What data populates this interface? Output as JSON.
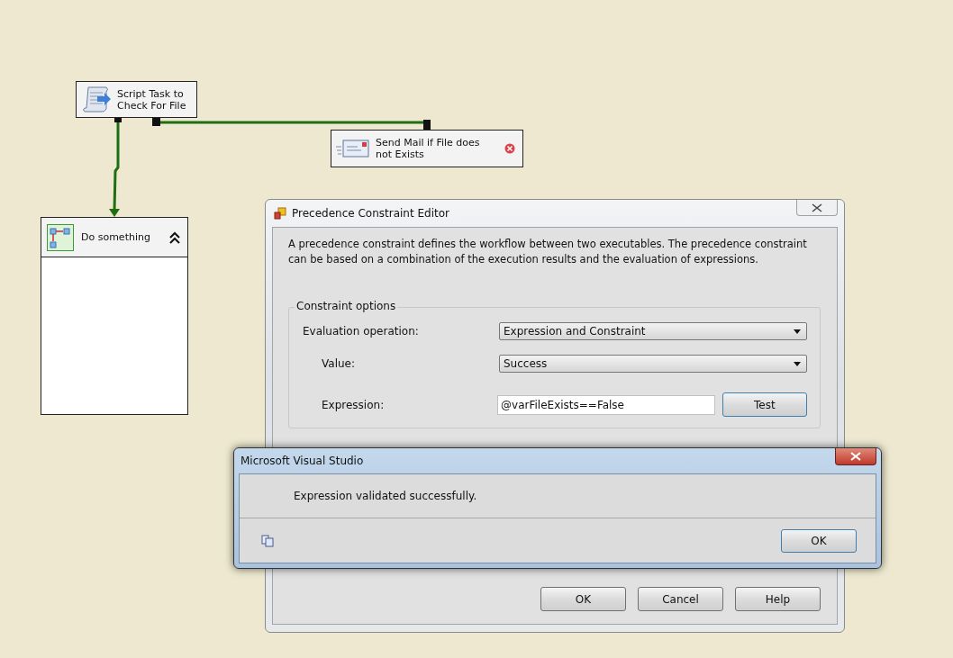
{
  "canvas": {
    "tasks": [
      {
        "label": "Script Task to Check For File",
        "kind": "script",
        "error": false
      },
      {
        "label": "Send Mail if File does not Exists",
        "kind": "mail",
        "error": true
      }
    ],
    "container": {
      "label": "Do something",
      "expanded": true
    }
  },
  "editor": {
    "title": "Precedence Constraint Editor",
    "description": "A precedence constraint defines the workflow between two executables. The precedence constraint can be based on a combination of the execution results and the evaluation of expressions.",
    "group": {
      "title": "Constraint options",
      "fields": [
        {
          "label": "Evaluation operation:",
          "kind": "combo",
          "value": "Expression and Constraint"
        },
        {
          "label": "Value:",
          "kind": "combo",
          "value": "Success"
        },
        {
          "label": "Expression:",
          "kind": "text",
          "value": "@varFileExists==False",
          "button": "Test"
        }
      ]
    },
    "buttons": [
      "OK",
      "Cancel",
      "Help"
    ]
  },
  "message_box": {
    "title": "Microsoft Visual Studio",
    "message": "Expression validated successfully.",
    "button": "OK"
  }
}
